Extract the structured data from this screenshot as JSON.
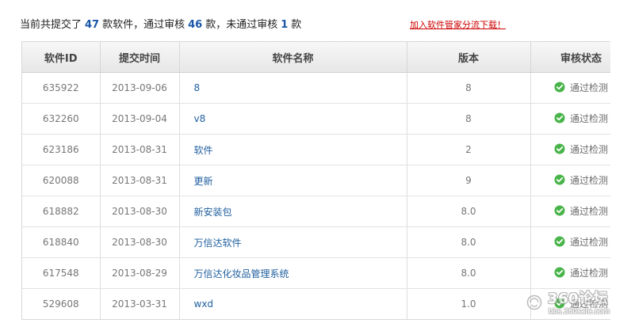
{
  "summary": {
    "prefix": "当前共提交了",
    "submitted_count": "47",
    "middle1": "款软件，通过审核",
    "passed_count": "46",
    "middle2": "款，未通过审核",
    "failed_count": "1",
    "suffix": "款",
    "link_text": "加入软件管家分流下载！"
  },
  "table": {
    "headers": {
      "software_id": "软件ID",
      "submit_time": "提交时间",
      "software_name": "软件名称",
      "version": "版本",
      "review_status": "审核状态"
    },
    "rows": [
      {
        "software_id": "635922",
        "submit_time": "2013-09-06",
        "software_name": "8",
        "version": "8",
        "review_status": "通过检测"
      },
      {
        "software_id": "632260",
        "submit_time": "2013-09-04",
        "software_name": "v8",
        "version": "8",
        "review_status": "通过检测"
      },
      {
        "software_id": "623186",
        "submit_time": "2013-08-31",
        "software_name": "软件",
        "version": "2",
        "review_status": "通过检测"
      },
      {
        "software_id": "620088",
        "submit_time": "2013-08-31",
        "software_name": "更新",
        "version": "9",
        "review_status": "通过检测"
      },
      {
        "software_id": "618882",
        "submit_time": "2013-08-30",
        "software_name": "新安装包",
        "version": "8.0",
        "review_status": "通过检测"
      },
      {
        "software_id": "618840",
        "submit_time": "2013-08-30",
        "software_name": "万信达软件",
        "version": "8.0",
        "review_status": "通过检测"
      },
      {
        "software_id": "617548",
        "submit_time": "2013-08-29",
        "software_name": "万信达化妆品管理系统",
        "version": "8.0",
        "review_status": "通过检测"
      },
      {
        "software_id": "529608",
        "submit_time": "2013-03-31",
        "software_name": "wxd",
        "version": "1.0",
        "review_status": "通过检测"
      }
    ]
  },
  "watermark": {
    "main_text": "360论坛",
    "sub_text": "bbs.360safe.com"
  },
  "colors": {
    "accent_blue": "#1f5f9f",
    "link_red": "#cc0000",
    "success_green": "#48b44a"
  }
}
